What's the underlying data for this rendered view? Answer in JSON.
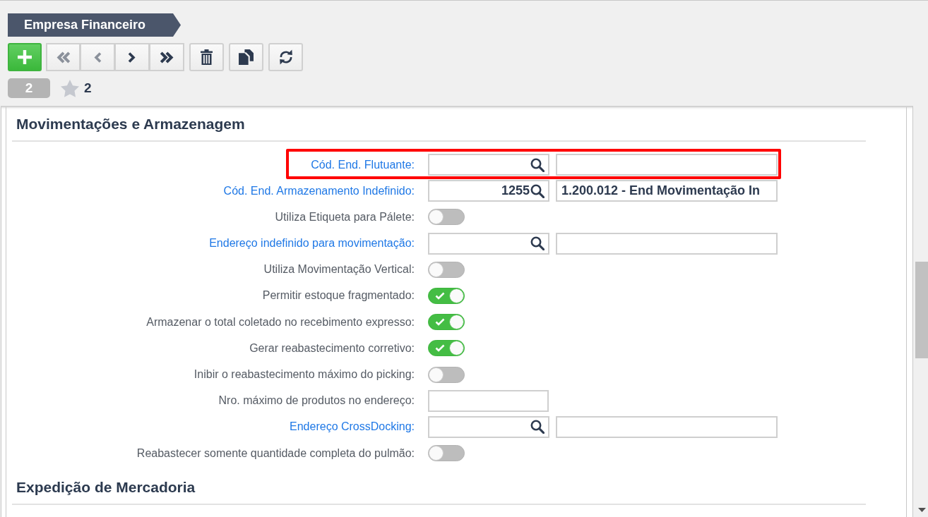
{
  "header": {
    "title": "Empresa Financeiro"
  },
  "toolbar": [
    {
      "kind": "add",
      "disabled": false
    },
    {
      "kind": "first",
      "disabled": true
    },
    {
      "kind": "previous",
      "disabled": true
    },
    {
      "kind": "next",
      "disabled": false
    },
    {
      "kind": "last",
      "disabled": false
    },
    {
      "kind": "delete",
      "disabled": false
    },
    {
      "kind": "copy",
      "disabled": false
    },
    {
      "kind": "refresh",
      "disabled": false
    }
  ],
  "record_info": {
    "count": "2",
    "favorites": "2"
  },
  "sections": [
    {
      "title": "Movimentações e Armazenagem",
      "rows": [
        {
          "kind": "lookup",
          "label": "Cód. End. Flutuante:",
          "highlighted": true
        },
        {
          "kind": "lookup",
          "label": "Cód. End. Armazenamento Indefinido:",
          "code": "1255",
          "description": "1.200.012 - End Movimentação In",
          "highlighted": false
        },
        {
          "kind": "toggle",
          "label": "Utiliza Etiqueta para Pálete:",
          "on": false,
          "highlighted": false
        },
        {
          "kind": "lookup",
          "label": "Endereço indefinido para movimentação:",
          "highlighted": false
        },
        {
          "kind": "toggle",
          "label": "Utiliza Movimentação Vertical:",
          "on": false,
          "highlighted": false
        },
        {
          "kind": "toggle",
          "label": "Permitir estoque fragmentado:",
          "on": true,
          "highlighted": false
        },
        {
          "kind": "toggle",
          "label": "Armazenar o total coletado no recebimento expresso:",
          "on": true,
          "highlighted": false
        },
        {
          "kind": "toggle",
          "label": "Gerar reabastecimento corretivo:",
          "on": true,
          "highlighted": false
        },
        {
          "kind": "toggle",
          "label": "Inibir o reabastecimento máximo do picking:",
          "on": false,
          "highlighted": false
        },
        {
          "kind": "text",
          "label": "Nro. máximo de produtos no endereço:",
          "highlighted": false
        },
        {
          "kind": "lookup",
          "label": "Endereço CrossDocking:",
          "highlighted": false
        },
        {
          "kind": "toggle",
          "label": "Reabastecer somente quantidade completa do pulmão:",
          "on": false,
          "highlighted": false
        }
      ]
    },
    {
      "title": "Expedição de Mercadoria"
    }
  ]
}
